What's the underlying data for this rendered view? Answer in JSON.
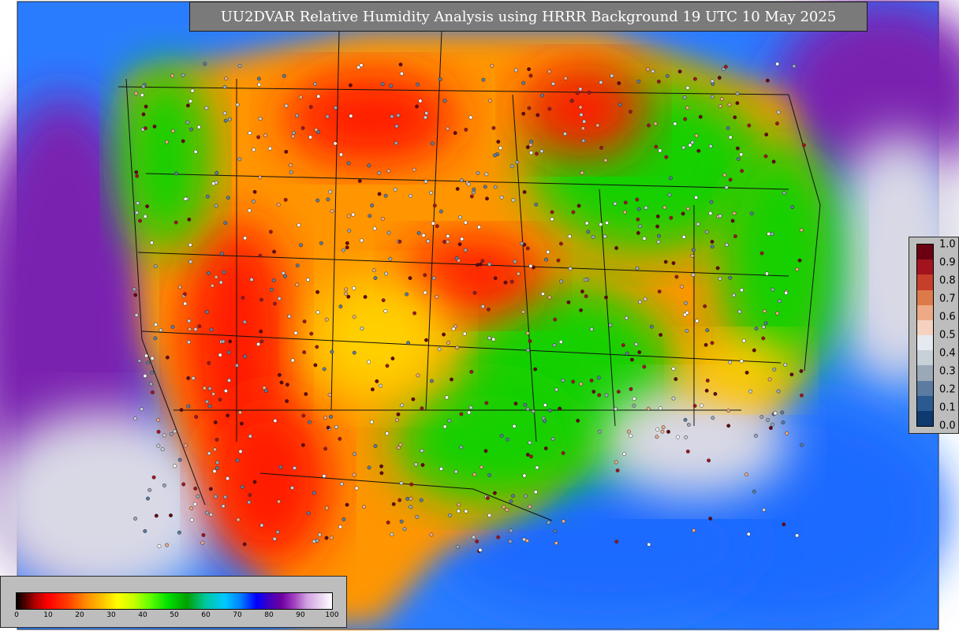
{
  "title": "UU2DVAR Relative Humidity Analysis using HRRR Background 19 UTC 10 May 2025",
  "colors": {
    "very_dry": "#ff1a00",
    "dry": "#ff9500",
    "medium": "#ffd000",
    "moist": "#18d000",
    "wet": "#1e6bff",
    "saturated": "#7a20b0",
    "near_saturated": "#d9d9e6",
    "gray_nodata": "#cfcfcf"
  },
  "legend_right": {
    "labels": [
      "1.0",
      "0.9",
      "0.8",
      "0.7",
      "0.6",
      "0.5",
      "0.4",
      "0.3",
      "0.2",
      "0.1",
      "0.0"
    ],
    "swatch_colors": [
      "#6a0011",
      "#a3131e",
      "#c63f2a",
      "#dd7a4a",
      "#eeaa86",
      "#f5d2c0",
      "#e6eaf0",
      "#c8d0d8",
      "#9aa8b8",
      "#5b7ba0",
      "#2a5a90",
      "#0e3a70"
    ]
  },
  "legend_bottom": {
    "ticks": [
      "0",
      "10",
      "20",
      "30",
      "40",
      "50",
      "60",
      "70",
      "80",
      "90",
      "100"
    ]
  }
}
